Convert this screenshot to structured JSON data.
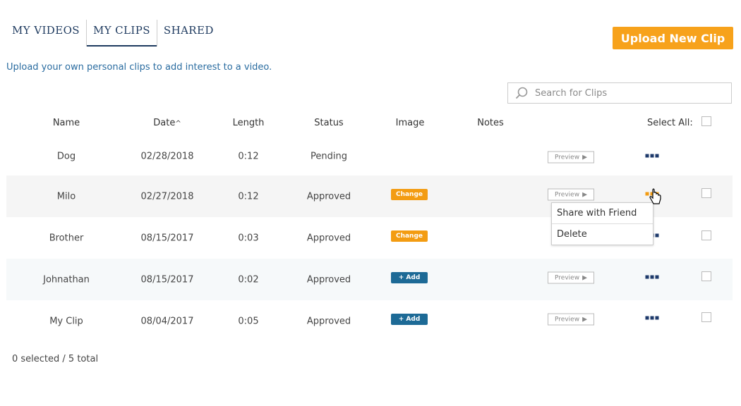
{
  "tabs": [
    {
      "label": "MY VIDEOS"
    },
    {
      "label": "MY CLIPS"
    },
    {
      "label": "SHARED"
    }
  ],
  "upload_button": "Upload New Clip",
  "subtitle": "Upload your own personal clips to add interest to a video.",
  "search": {
    "placeholder": "Search for Clips",
    "value": ""
  },
  "headers": {
    "name": "Name",
    "date": "Date",
    "date_sort": "^",
    "length": "Length",
    "status": "Status",
    "image": "Image",
    "notes": "Notes",
    "select_all": "Select All:"
  },
  "rows": [
    {
      "name": "Dog",
      "date": "02/28/2018",
      "length": "0:12",
      "status": "Pending",
      "image_action": "",
      "preview": "Preview"
    },
    {
      "name": "Milo",
      "date": "02/27/2018",
      "length": "0:12",
      "status": "Approved",
      "image_action": "Change",
      "preview": "Preview"
    },
    {
      "name": "Brother",
      "date": "08/15/2017",
      "length": "0:03",
      "status": "Approved",
      "image_action": "Change",
      "preview": "Preview"
    },
    {
      "name": "Johnathan",
      "date": "08/15/2017",
      "length": "0:02",
      "status": "Approved",
      "image_action": "+ Add",
      "preview": "Preview"
    },
    {
      "name": "My Clip",
      "date": "08/04/2017",
      "length": "0:05",
      "status": "Approved",
      "image_action": "+ Add",
      "preview": "Preview"
    }
  ],
  "context_menu": {
    "items": [
      "Share with Friend",
      "Delete"
    ]
  },
  "footer": "0 selected / 5 total",
  "colors": {
    "accent": "#f7a21b",
    "nav": "#1e3a5f",
    "add": "#1d6a96",
    "link": "#2a6ca0"
  }
}
